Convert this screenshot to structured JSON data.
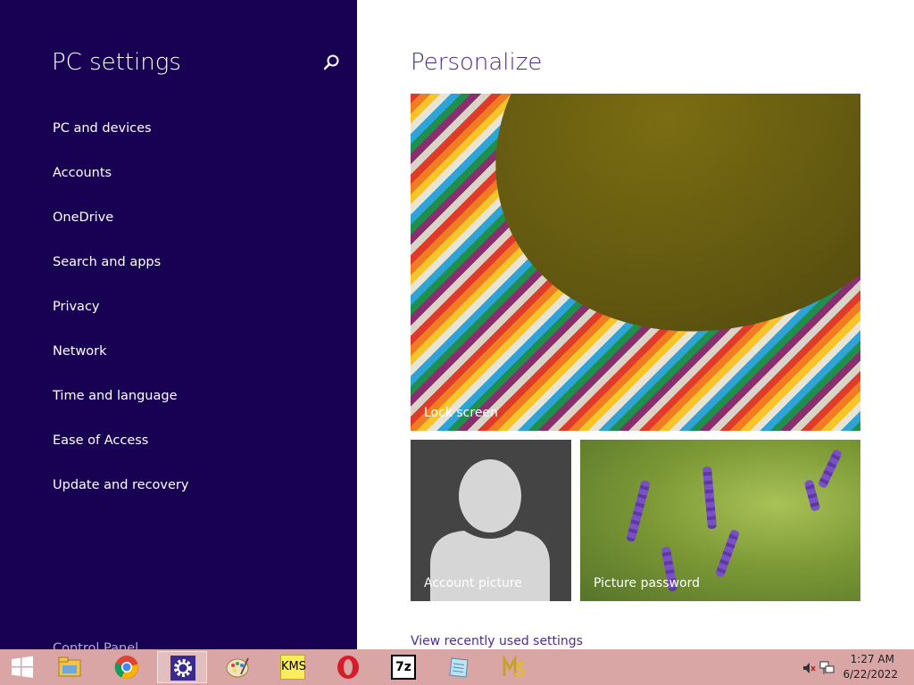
{
  "sidebar": {
    "title": "PC settings",
    "items": [
      {
        "label": "PC and devices"
      },
      {
        "label": "Accounts"
      },
      {
        "label": "OneDrive"
      },
      {
        "label": "Search and apps"
      },
      {
        "label": "Privacy"
      },
      {
        "label": "Network"
      },
      {
        "label": "Time and language"
      },
      {
        "label": "Ease of Access"
      },
      {
        "label": "Update and recovery"
      }
    ],
    "control_panel": "Control Panel",
    "search_icon": "search-icon"
  },
  "main": {
    "title": "Personalize",
    "tiles": {
      "lock_screen": "Lock screen",
      "account_picture": "Account picture",
      "picture_password": "Picture password"
    },
    "recent_link": "View recently used settings"
  },
  "taskbar": {
    "start_icon": "windows-start-icon",
    "apps": [
      {
        "name": "file-explorer-icon"
      },
      {
        "name": "chrome-icon"
      },
      {
        "name": "settings-gear-icon",
        "active": true
      },
      {
        "name": "paint-palette-icon"
      },
      {
        "name": "kms-icon",
        "text": "KMS"
      },
      {
        "name": "opera-icon"
      },
      {
        "name": "7zip-icon",
        "text": "7z"
      },
      {
        "name": "notepad-icon"
      },
      {
        "name": "ms-keys-icon"
      }
    ],
    "tray": {
      "volume_icon": "speaker-muted-icon",
      "network_icon": "network-icon",
      "time": "1:27 AM",
      "date": "6/22/2022"
    }
  },
  "colors": {
    "sidebar_bg": "#180052",
    "accent_text": "#4d2c8f",
    "taskbar_bg": "#d9a5a5"
  }
}
